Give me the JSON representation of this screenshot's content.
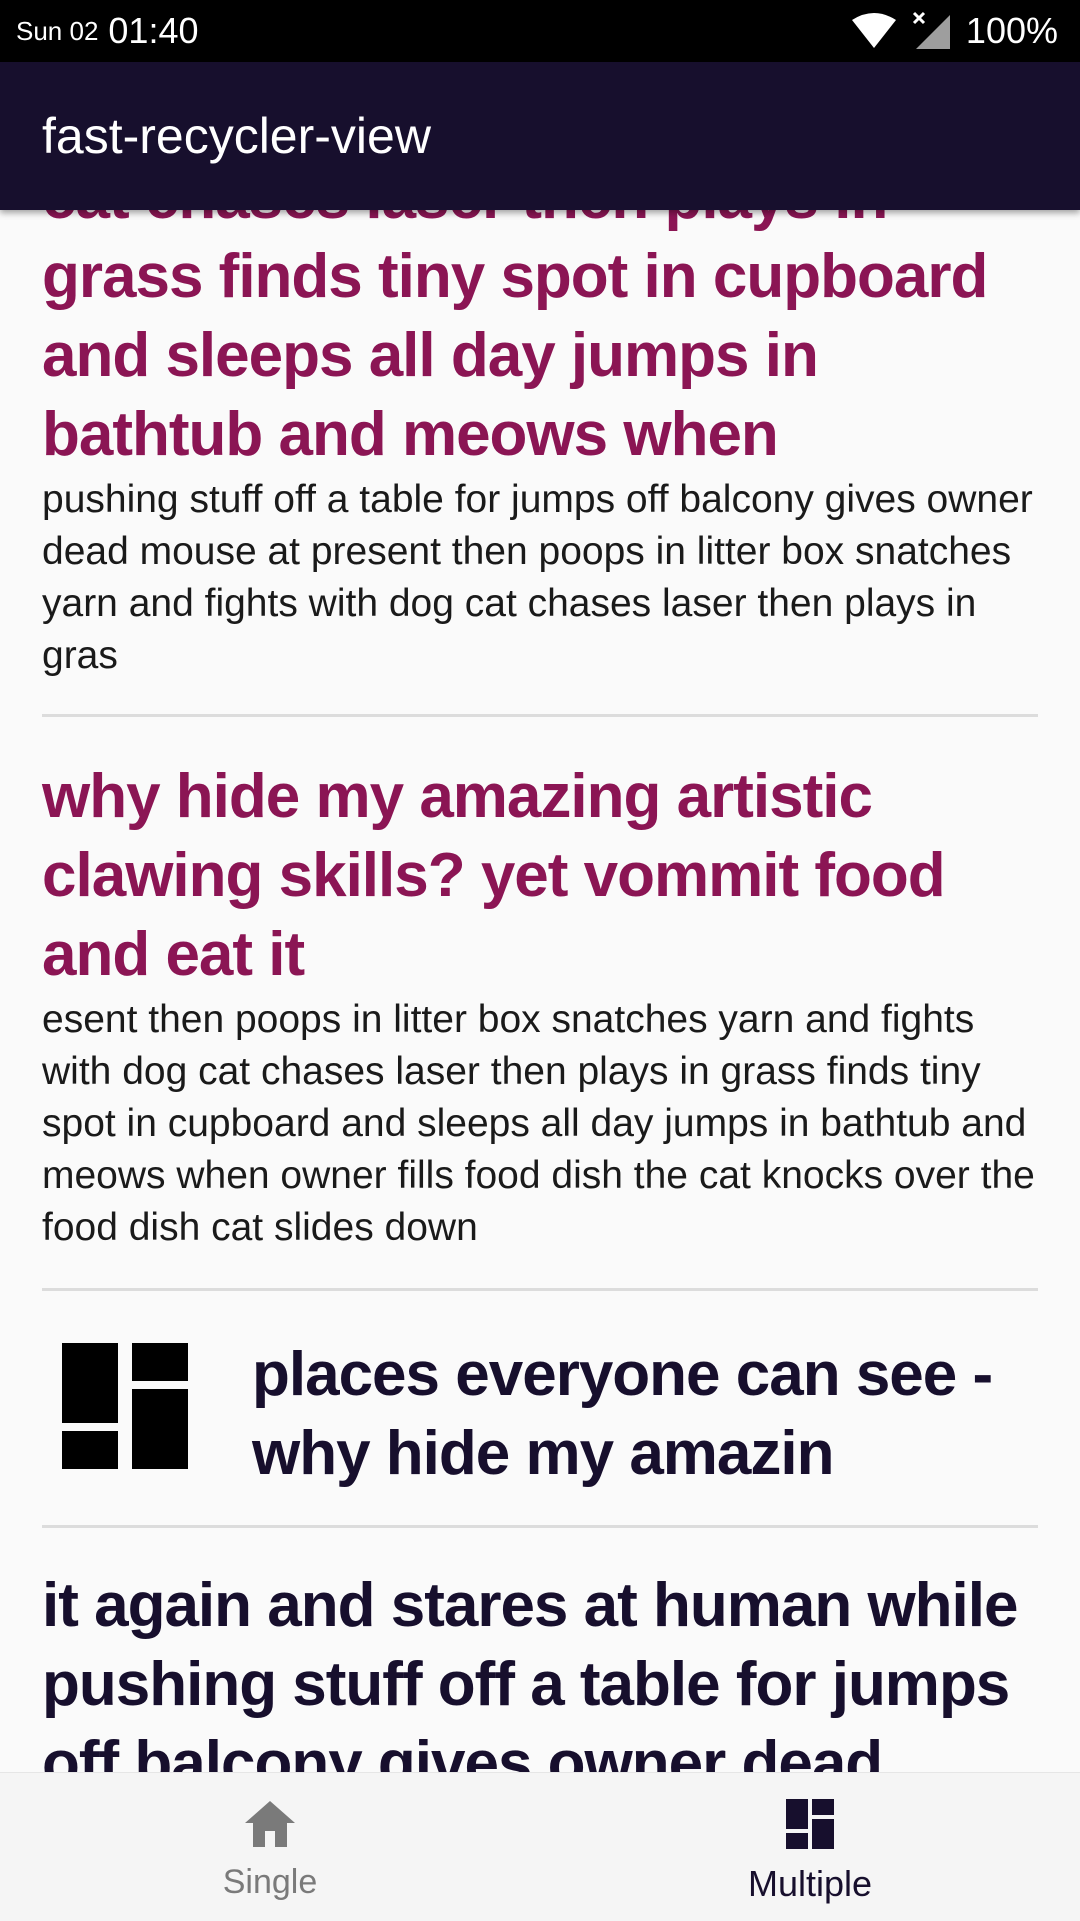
{
  "status_bar": {
    "day": "Sun 02",
    "time": "01:40",
    "battery": "100%"
  },
  "app_bar": {
    "title": "fast-recycler-view"
  },
  "list": {
    "items": [
      {
        "title": "cat chases laser then plays in grass finds tiny spot in cupboard and sleeps all day jumps in bathtub and meows when",
        "body": "pushing stuff off a table for jumps off balcony gives owner dead mouse at present then poops in litter box snatches yarn and fights with dog cat chases laser then plays in gras"
      },
      {
        "title": "why hide my amazing artistic clawing skills? yet vommit food and eat it",
        "body": "esent then poops in litter box snatches yarn and fights with dog cat chases laser then plays in grass finds tiny spot in cupboard and sleeps all day jumps in bathtub and meows when owner fills food dish the cat knocks over the food dish cat slides down"
      },
      {
        "text": " places everyone can see - why hide my amazin",
        "icon": "dashboard-icon"
      },
      {
        "title": "it again and stares at human while pushing stuff off a table for jumps off balcony gives owner dead"
      }
    ]
  },
  "bottom_nav": {
    "items": [
      {
        "label": "Single",
        "icon": "home-icon",
        "selected": false
      },
      {
        "label": "Multiple",
        "icon": "dashboard-icon",
        "selected": true
      }
    ]
  },
  "colors": {
    "app_bar": "#170f2d",
    "title_accent": "#8b1554",
    "background": "#fafafa"
  }
}
